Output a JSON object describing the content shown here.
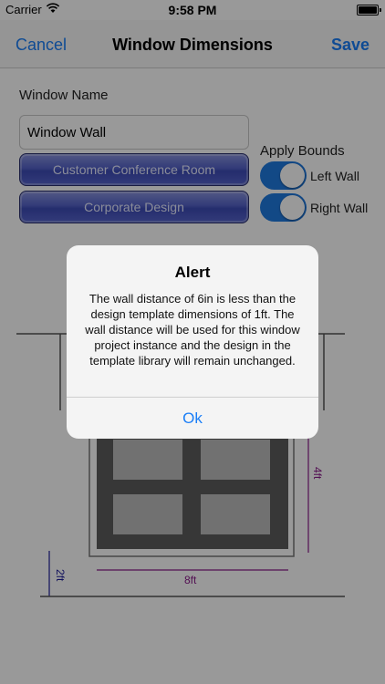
{
  "status_bar": {
    "carrier": "Carrier",
    "time": "9:58 PM"
  },
  "nav": {
    "cancel_label": "Cancel",
    "title": "Window Dimensions",
    "save_label": "Save"
  },
  "form": {
    "window_name_label": "Window Name",
    "window_name_value": "Window Wall",
    "customer_button": "Customer Conference Room",
    "design_button": "Corporate Design",
    "apply_bounds_label": "Apply Bounds",
    "left_wall_label": "Left Wall",
    "right_wall_label": "Right Wall",
    "left_wall_on": true,
    "right_wall_on": true
  },
  "drawing": {
    "height_label": "4ft",
    "width_label": "8ft",
    "sill_label": "2ft"
  },
  "alert": {
    "title": "Alert",
    "message": "The wall distance of 6in is less than the design template dimensions of 1ft. The wall distance will be used for this window project instance and the design in the template library will remain unchanged.",
    "ok_label": "Ok"
  },
  "colors": {
    "accent": "#1a7ef7",
    "switch_on": "#1f7ae0",
    "dimension_purple": "#8a1b8a"
  }
}
